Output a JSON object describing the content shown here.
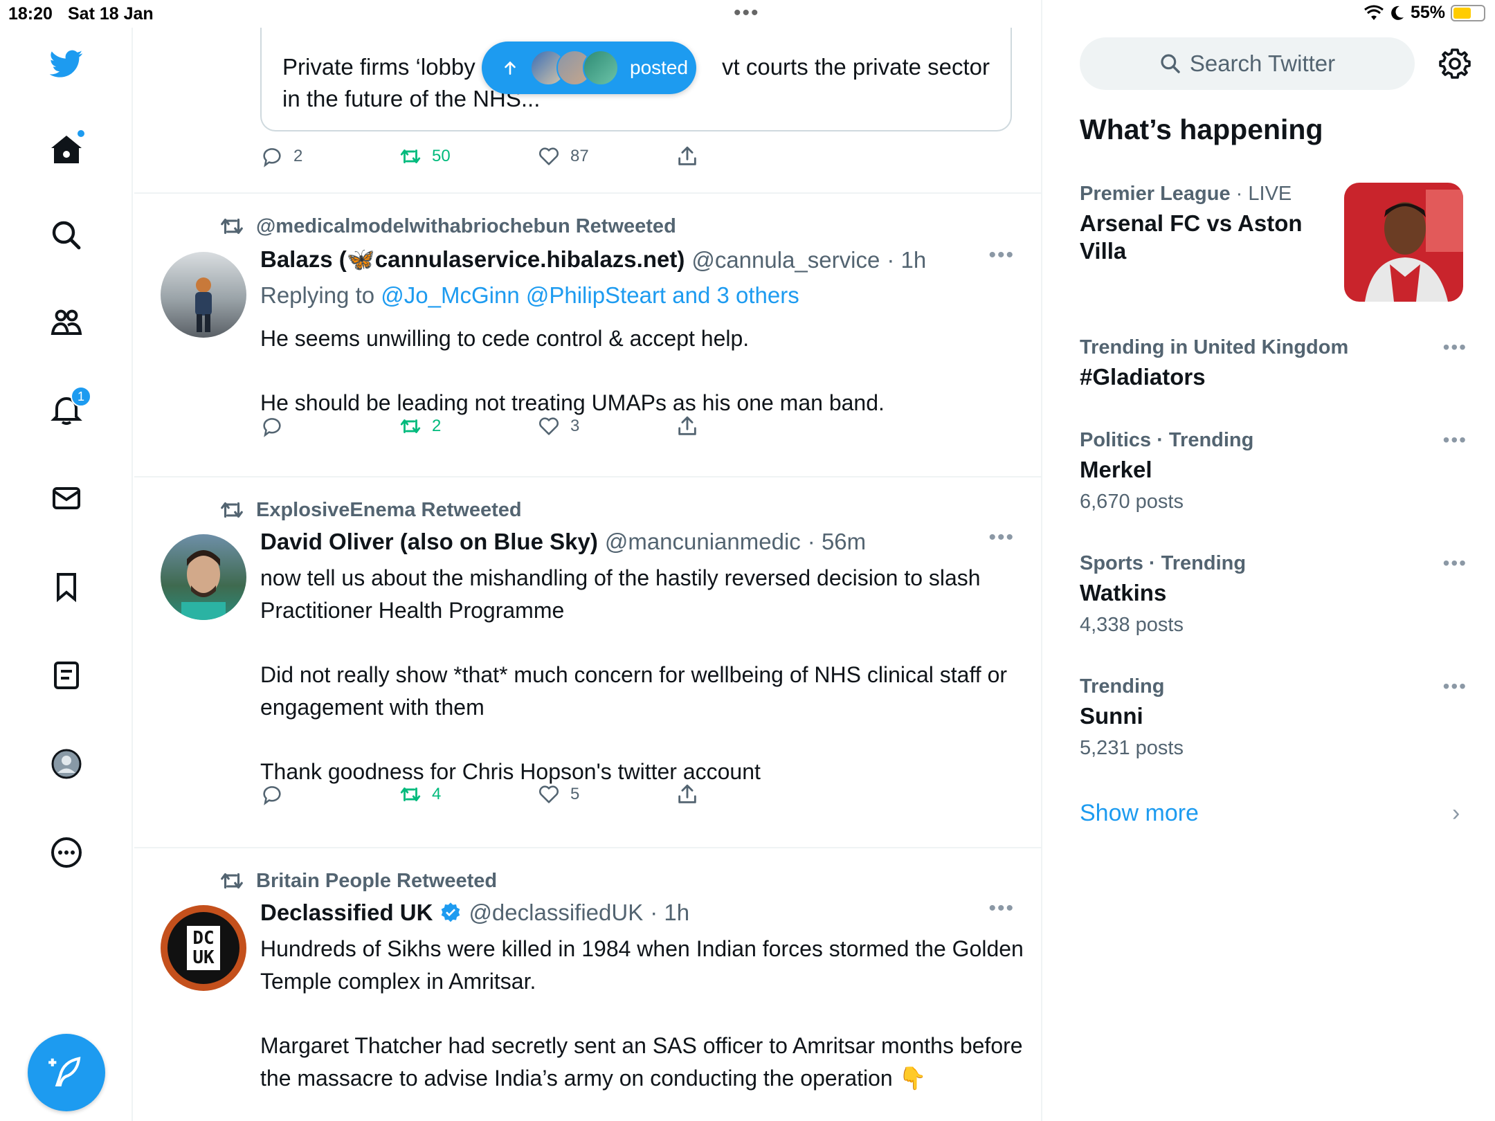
{
  "status_bar": {
    "time": "18:20",
    "date": "Sat 18 Jan",
    "battery": "55%"
  },
  "nav": {
    "notifications_badge": "1"
  },
  "quoted_tweet": {
    "text": "Private firms ‘lobby ... vt courts the private sector in the future of the NHS...",
    "line1_left": "Private firms ‘lobby",
    "line1_right": "vt courts the private sector",
    "line2": "in the future of the NHS..."
  },
  "posted_pill": {
    "label": "posted"
  },
  "tweets": [
    {
      "actions": {
        "replies": "2",
        "retweets": "50",
        "likes": "87"
      }
    },
    {
      "retweeted_by": "@medicalmodelwithabriochebun Retweeted",
      "name": "Balazs (🦋cannulaservice.hibalazs.net)",
      "handle": "@cannula_service",
      "time": "· 1h",
      "replying_prefix": "Replying to",
      "replying_to": "@Jo_McGinn @PhilipSteart and 3 others",
      "paragraphs": [
        "He seems unwilling to cede control & accept help.",
        "He should be leading not treating UMAPs as his one man band."
      ],
      "actions": {
        "replies": "",
        "retweets": "2",
        "likes": "3"
      }
    },
    {
      "retweeted_by": "ExplosiveEnema Retweeted",
      "name": "David Oliver (also on Blue Sky)",
      "handle": "@mancunianmedic",
      "time": "· 56m",
      "paragraphs": [
        "now tell us about the mishandling of the hastily reversed decision to slash Practitioner Health Programme",
        "Did not really show *that* much concern for wellbeing of NHS clinical staff or engagement with them",
        "Thank goodness for Chris Hopson's twitter account"
      ],
      "actions": {
        "replies": "",
        "retweets": "4",
        "likes": "5"
      }
    },
    {
      "retweeted_by": "Britain People Retweeted",
      "name": "Declassified UK",
      "handle": "@declassifiedUK",
      "time": "· 1h",
      "avatar_text": "DC UK",
      "paragraphs": [
        "Hundreds of Sikhs were killed in 1984 when Indian forces stormed the Golden Temple complex in Amritsar.",
        "Margaret Thatcher had secretly sent an SAS officer to Amritsar months before the massacre to advise India’s army on conducting the operation 👇"
      ]
    }
  ],
  "sidebar": {
    "search_placeholder": "Search Twitter",
    "whats_happening": "What’s happening",
    "trends": [
      {
        "category": "Premier League",
        "category_suffix": " · LIVE",
        "title": "Arsenal FC vs Aston Villa",
        "count": ""
      },
      {
        "category": "Trending in United Kingdom",
        "category_suffix": "",
        "title": "#Gladiators",
        "count": ""
      },
      {
        "category": "Politics · Trending",
        "category_suffix": "",
        "title": "Merkel",
        "count": "6,670 posts"
      },
      {
        "category": "Sports · Trending",
        "category_suffix": "",
        "title": "Watkins",
        "count": "4,338 posts"
      },
      {
        "category": "Trending",
        "category_suffix": "",
        "title": "Sunni",
        "count": "5,231 posts"
      }
    ],
    "show_more": "Show more"
  },
  "colors": {
    "accent": "#1d9bf0",
    "retweet_green": "#00ba7c",
    "text_secondary": "#536471"
  }
}
